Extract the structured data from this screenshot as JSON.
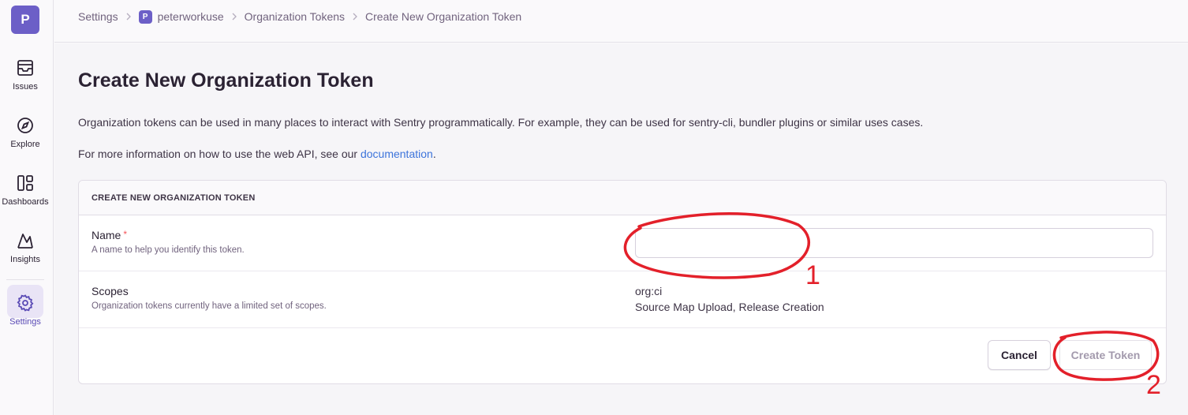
{
  "sidebar": {
    "org_initial": "P",
    "items": [
      {
        "label": "Issues",
        "icon": "inbox-icon"
      },
      {
        "label": "Explore",
        "icon": "compass-icon"
      },
      {
        "label": "Dashboards",
        "icon": "dashboard-icon"
      },
      {
        "label": "Insights",
        "icon": "graph-icon"
      },
      {
        "label": "Settings",
        "icon": "gear-icon",
        "active": true
      }
    ]
  },
  "breadcrumb": {
    "settings": "Settings",
    "org_initial": "P",
    "org": "peterworkuse",
    "tokens": "Organization Tokens",
    "current": "Create New Organization Token"
  },
  "page": {
    "title": "Create New Organization Token",
    "description": "Organization tokens can be used in many places to interact with Sentry programmatically. For example, they can be used for sentry-cli, bundler plugins or similar uses cases.",
    "info_prefix": "For more information on how to use the web API, see our ",
    "info_link": "documentation",
    "info_suffix": "."
  },
  "panel": {
    "header": "CREATE NEW ORGANIZATION TOKEN",
    "name_label": "Name",
    "name_required": "*",
    "name_help": "A name to help you identify this token.",
    "name_value": "",
    "name_placeholder": "",
    "scopes_label": "Scopes",
    "scopes_help": "Organization tokens currently have a limited set of scopes.",
    "scope_name": "org:ci",
    "scope_desc": "Source Map Upload, Release Creation",
    "cancel": "Cancel",
    "create": "Create Token"
  },
  "annotations": {
    "marker_1": "1",
    "marker_2": "2",
    "color": "#e3202a"
  },
  "colors": {
    "accent": "#6c5fc7",
    "link": "#3d74db",
    "required": "#f55459"
  }
}
